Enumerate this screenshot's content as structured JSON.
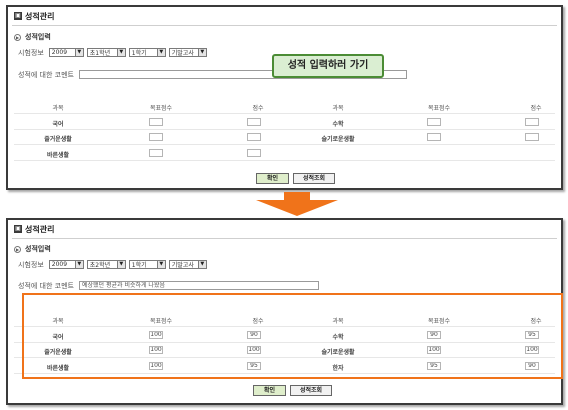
{
  "panel_title": "성적관리",
  "section_title": "성적입력",
  "exam_info_label": "시험정보",
  "comment_label": "성적에 대한 코멘트",
  "headers": {
    "subject": "과목",
    "target": "목표점수",
    "score": "점수"
  },
  "callout_text": "성적 입력하러 가기",
  "buttons": {
    "confirm": "확인",
    "view": "성적조회"
  },
  "colors": {
    "highlight": "#f0731a",
    "arrow": "#f0731a",
    "callout_border": "#4b8c35",
    "callout_bg": "#daeed2"
  },
  "top": {
    "year": "2009",
    "grade": "초1학년",
    "semester": "1학기",
    "exam": "기말고사",
    "comment_value": "",
    "subjects": {
      "r1c1": "국어",
      "r1c2": "수학",
      "r2c1": "즐거운생활",
      "r2c2": "슬기로운생활",
      "r3c1": "바른생활"
    }
  },
  "bottom": {
    "year": "2009",
    "grade": "초2학년",
    "semester": "1학기",
    "exam": "기말고사",
    "comment_value": "예상했던 평균과 비슷하게 나왔음",
    "subjects": {
      "r1c1": "국어",
      "r1c2": "수학",
      "r2c1": "즐거운생활",
      "r2c2": "슬기로운생활",
      "r3c1": "바른생활",
      "r3c2": "한자"
    },
    "scores": {
      "r1c1_target": "100",
      "r1c1_score": "90",
      "r1c2_target": "90",
      "r1c2_score": "95",
      "r2c1_target": "100",
      "r2c1_score": "100",
      "r2c2_target": "100",
      "r2c2_score": "100",
      "r3c1_target": "100",
      "r3c1_score": "95",
      "r3c2_target": "95",
      "r3c2_score": "90"
    }
  }
}
